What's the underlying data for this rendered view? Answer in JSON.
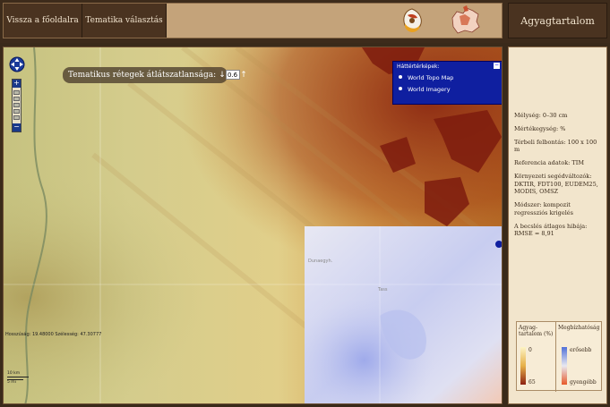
{
  "nav": {
    "home_label": "Vissza a főoldalra",
    "theme_label": "Tematika választás",
    "panel_title": "Agyagtartalom"
  },
  "map": {
    "opacity_label": "Tematikus rétegek átlátszatlansága:",
    "opacity_value": "0.6",
    "basemap_header": "Háttértérképek:",
    "basemap_options": [
      "World Topo Map",
      "World Imagery"
    ],
    "coords": "Hosszúság: 19.48000 Szélesség: 47.30777",
    "scale_top": "10 km",
    "scale_bottom": "5 mi",
    "place_label_1": "Dunaegyh.",
    "place_label_2": "Tass"
  },
  "info": {
    "depth": "Mélység: 0–30 cm",
    "unit": "Mértékegység: %",
    "resolution": "Térbeli felbontás: 100 x 100 m",
    "reference": "Referencia adatok: TIM",
    "aux": "Környezeti segédváltozók: DKTIR, FDT100, EUDEM25, MODIS, OMSZ",
    "method": "Módszer: kompozit regressziós krigelés",
    "rmse": "A becslés átlagos hibája: RMSE = 8,91"
  },
  "legend": {
    "clay_title": "Agyag-tartalom (%)",
    "clay_min": "0",
    "clay_max": "65",
    "rel_title": "Megbízhatóság",
    "rel_top": "erősebb",
    "rel_bottom": "gyengébb"
  }
}
